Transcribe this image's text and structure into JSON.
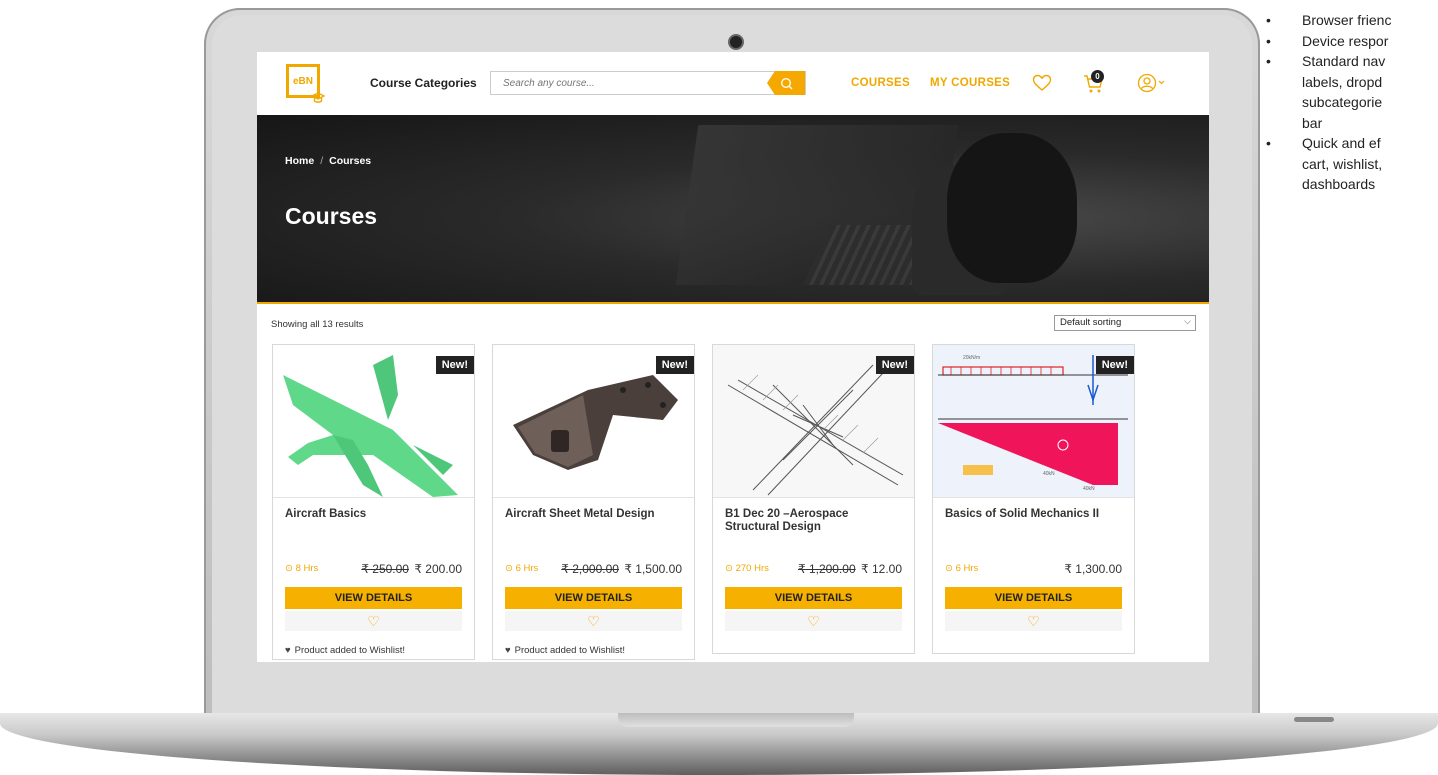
{
  "header": {
    "logo_text": "eBN",
    "categories_label": "Course Categories",
    "search_placeholder": "Search any course...",
    "nav": {
      "courses": "COURSES",
      "my_courses": "MY COURSES"
    },
    "cart_count": "0"
  },
  "hero": {
    "breadcrumb": {
      "home": "Home",
      "separator": "/",
      "current": "Courses"
    },
    "title": "Courses"
  },
  "listing": {
    "results_text": "Showing all 13 results",
    "sort_value": "Default sorting"
  },
  "courses": [
    {
      "title": "Aircraft Basics",
      "hours": "8 Hrs",
      "old_price": "₹ 250.00",
      "price": "₹ 200.00",
      "badge": "New!",
      "button": "VIEW DETAILS",
      "wishlist_message": "Product added to Wishlist!"
    },
    {
      "title": "Aircraft Sheet Metal Design",
      "hours": "6 Hrs",
      "old_price": "₹ 2,000.00",
      "price": "₹ 1,500.00",
      "badge": "New!",
      "button": "VIEW DETAILS",
      "wishlist_message": "Product added to Wishlist!"
    },
    {
      "title": "B1 Dec 20 –Aerospace Structural Design",
      "hours": "270 Hrs",
      "old_price": "₹ 1,200.00",
      "price": "₹ 12.00",
      "badge": "New!",
      "button": "VIEW DETAILS",
      "wishlist_message": ""
    },
    {
      "title": "Basics of Solid Mechanics II",
      "hours": "6 Hrs",
      "old_price": "",
      "price": "₹ 1,300.00",
      "badge": "New!",
      "button": "VIEW DETAILS",
      "wishlist_message": ""
    }
  ],
  "feature_bullets": [
    "Browser frienc",
    "Device respor",
    "Standard nav",
    "labels, dropd",
    "subcategorie",
    "bar",
    "Quick and ef",
    "cart, wishlist,",
    "dashboards"
  ],
  "colors": {
    "accent": "#f5b000",
    "hero_bg": "#1e1e1e",
    "dark": "#222222"
  },
  "icons": [
    "search-icon",
    "heart-icon",
    "cart-icon",
    "user-icon",
    "clock-icon",
    "graduation-cap-icon"
  ]
}
